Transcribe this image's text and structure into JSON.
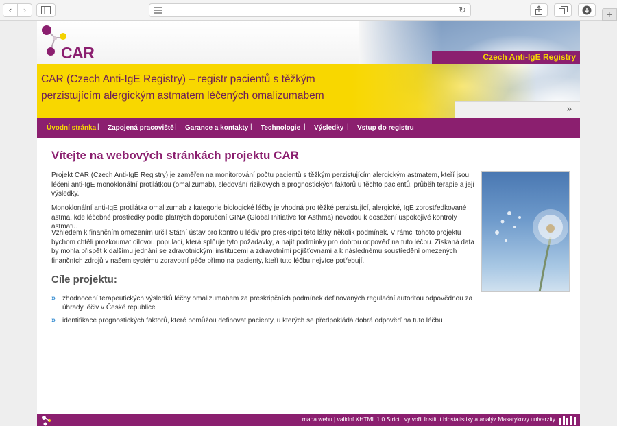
{
  "browser": {
    "back_icon": "chevron-left",
    "forward_icon": "chevron-right",
    "sidebar_icon": "sidebar",
    "reader_icon": "reader-lines",
    "reload_icon": "reload",
    "share_icon": "share",
    "tabs_icon": "tabs",
    "download_icon": "download",
    "new_tab_icon": "plus"
  },
  "header": {
    "logo_text": "CAR",
    "registry_label": "Czech Anti-IgE Registry",
    "headline": "CAR (Czech Anti-IgE Registry) – registr pacientů s těžkým perzistujícím alergickým astmatem léčených omalizumabem",
    "search_arrow": "»"
  },
  "nav": {
    "items": [
      {
        "label": "Úvodní stránka",
        "active": true
      },
      {
        "label": "Zapojená pracoviště"
      },
      {
        "label": "Garance a kontakty"
      },
      {
        "label": "Technologie"
      },
      {
        "label": "Výsledky"
      },
      {
        "label": "Vstup do registru"
      }
    ],
    "separator": "|"
  },
  "content": {
    "title": "Vítejte na webových stránkách projektu CAR",
    "paragraphs": [
      "Projekt CAR (Czech Anti-IgE Registry) je zaměřen na monitorování počtu pacientů s těžkým perzistujícím alergickým astmatem, kteří jsou léčeni anti-IgE monoklonální protilátkou (omalizumab), sledování rizikových a prognostických faktorů u těchto pacientů, průběh terapie a její výsledky.",
      "Monoklonální anti-IgE protilátka omalizumab z kategorie biologické léčby je vhodná pro těžké perzistující, alergické, IgE zprostředkované astma, kde léčebné prostředky podle platných doporučení GINA (Global Initiative for Asthma) nevedou k dosažení uspokojivé kontroly astmatu.",
      "Vzhledem k finančním omezením určil Státní ústav pro kontrolu léčiv pro preskripci této látky několik podmínek. V rámci tohoto projektu bychom chtěli prozkoumat cílovou populaci, která splňuje tyto požadavky, a najít podmínky pro dobrou odpověď na tuto léčbu. Získaná data by mohla přispět k dalšímu jednání se zdravotnickými institucemi a zdravotními pojišťovnami a k následnému soustředění omezených finančních zdrojů v našem systému zdravotní péče přímo na pacienty, kteří tuto léčbu nejvíce potřebují."
    ],
    "goals_title": "Cíle projektu:",
    "goals": [
      "zhodnocení terapeutických výsledků léčby omalizumabem za preskripčních podmínek definovaných regulační autoritou odpovědnou za úhrady léčiv v České republice",
      "identifikace prognostických faktorů, které pomůžou definovat pacienty, u kterých se předpokládá dobrá odpověď na tuto léčbu"
    ],
    "goal_bullet": "»"
  },
  "footer": {
    "text": "mapa webu | validní XHTML 1.0 Strict | vytvořil Institut biostatistiky a analýz Masarykovy univerzity"
  },
  "colors": {
    "brand_purple": "#8b1f6f",
    "brand_yellow": "#f8d700",
    "link_blue": "#3a8fd2"
  }
}
